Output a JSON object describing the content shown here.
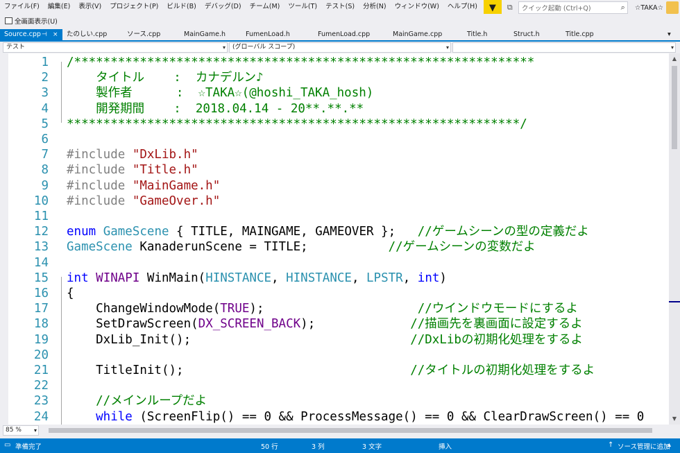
{
  "menubar": {
    "items": [
      "ファイル(F)",
      "編集(E)",
      "表示(V)",
      "プロジェクト(P)",
      "ビルド(B)",
      "デバッグ(D)",
      "チーム(M)",
      "ツール(T)",
      "テスト(S)",
      "分析(N)",
      "ウィンドウ(W)",
      "ヘルプ(H)"
    ],
    "quick_launch_placeholder": "クイック起動 (Ctrl+Q)",
    "user_name": "☆TAKA☆"
  },
  "toolbar": {
    "fullscreen_label": "全画面表示(U)"
  },
  "tabs": [
    {
      "label": "Source.cpp",
      "active": true
    },
    {
      "label": "たのしい.cpp"
    },
    {
      "label": "ソース.cpp"
    },
    {
      "label": "MainGame.h"
    },
    {
      "label": "FumenLoad.h"
    },
    {
      "label": "FumenLoad.cpp"
    },
    {
      "label": "MainGame.cpp"
    },
    {
      "label": "Title.h"
    },
    {
      "label": "Struct.h"
    },
    {
      "label": "Title.cpp"
    }
  ],
  "navbar": {
    "project": "テスト",
    "scope": "(グローバル スコープ)",
    "member": ""
  },
  "code": [
    {
      "n": "1",
      "segs": [
        [
          "cmt",
          "/***************************************************************"
        ]
      ]
    },
    {
      "n": "2",
      "segs": [
        [
          "cmt",
          "    タイトル    :  カナデルン♪"
        ]
      ]
    },
    {
      "n": "3",
      "segs": [
        [
          "cmt",
          "    製作者      :  ☆TAKA☆(@hoshi_TAKA_hosh)"
        ]
      ]
    },
    {
      "n": "4",
      "segs": [
        [
          "cmt",
          "    開発期間    :  2018.04.14 - 20**.**.**"
        ]
      ]
    },
    {
      "n": "5",
      "segs": [
        [
          "cmt",
          "**************************************************************/"
        ]
      ]
    },
    {
      "n": "6",
      "segs": []
    },
    {
      "n": "7",
      "segs": [
        [
          "pp",
          "#include "
        ],
        [
          "str",
          "\"DxLib.h\""
        ]
      ]
    },
    {
      "n": "8",
      "segs": [
        [
          "pp",
          "#include "
        ],
        [
          "str",
          "\"Title.h\""
        ]
      ]
    },
    {
      "n": "9",
      "segs": [
        [
          "pp",
          "#include "
        ],
        [
          "str",
          "\"MainGame.h\""
        ]
      ]
    },
    {
      "n": "10",
      "segs": [
        [
          "pp",
          "#include "
        ],
        [
          "str",
          "\"GameOver.h\""
        ]
      ]
    },
    {
      "n": "11",
      "segs": []
    },
    {
      "n": "12",
      "segs": [
        [
          "kw",
          "enum "
        ],
        [
          "typ",
          "GameScene"
        ],
        [
          "txt",
          " { TITLE, MAINGAME, GAMEOVER };   "
        ],
        [
          "cmt",
          "//ゲームシーンの型の定義だよ"
        ]
      ]
    },
    {
      "n": "13",
      "segs": [
        [
          "typ",
          "GameScene"
        ],
        [
          "txt",
          " KanaderunScene = TITLE;           "
        ],
        [
          "cmt",
          "//ゲームシーンの変数だよ"
        ]
      ]
    },
    {
      "n": "14",
      "segs": []
    },
    {
      "n": "15",
      "segs": [
        [
          "kw",
          "int "
        ],
        [
          "mac",
          "WINAPI"
        ],
        [
          "txt",
          " WinMain("
        ],
        [
          "typ",
          "HINSTANCE"
        ],
        [
          "txt",
          ", "
        ],
        [
          "typ",
          "HINSTANCE"
        ],
        [
          "txt",
          ", "
        ],
        [
          "typ",
          "LPSTR"
        ],
        [
          "txt",
          ", "
        ],
        [
          "kw",
          "int"
        ],
        [
          "txt",
          ")"
        ]
      ]
    },
    {
      "n": "16",
      "segs": [
        [
          "txt",
          "{"
        ]
      ]
    },
    {
      "n": "17",
      "segs": [
        [
          "txt",
          "    ChangeWindowMode("
        ],
        [
          "mac",
          "TRUE"
        ],
        [
          "txt",
          ");                     "
        ],
        [
          "cmt",
          "//ウインドウモードにするよ"
        ]
      ]
    },
    {
      "n": "18",
      "segs": [
        [
          "txt",
          "    SetDrawScreen("
        ],
        [
          "mac",
          "DX_SCREEN_BACK"
        ],
        [
          "txt",
          ");             "
        ],
        [
          "cmt",
          "//描画先を裏画面に設定するよ"
        ]
      ]
    },
    {
      "n": "19",
      "segs": [
        [
          "txt",
          "    DxLib_Init();                              "
        ],
        [
          "cmt",
          "//DxLibの初期化処理をするよ"
        ]
      ]
    },
    {
      "n": "20",
      "segs": []
    },
    {
      "n": "21",
      "segs": [
        [
          "txt",
          "    TitleInit();                               "
        ],
        [
          "cmt",
          "//タイトルの初期化処理をするよ"
        ]
      ]
    },
    {
      "n": "22",
      "segs": []
    },
    {
      "n": "23",
      "segs": [
        [
          "cmt",
          "    //メインループだよ"
        ]
      ]
    },
    {
      "n": "24",
      "segs": [
        [
          "kw",
          "    while"
        ],
        [
          "txt",
          " (ScreenFlip() == 0 && ProcessMessage() == 0 && ClearDrawScreen() == 0"
        ]
      ]
    }
  ],
  "bottombar": {
    "zoom": "85 %"
  },
  "statusbar": {
    "state": "準備完了",
    "line": "50 行",
    "column": "3 列",
    "char": "3 文字",
    "mode": "挿入",
    "source_control": "ソース管理に追加"
  }
}
